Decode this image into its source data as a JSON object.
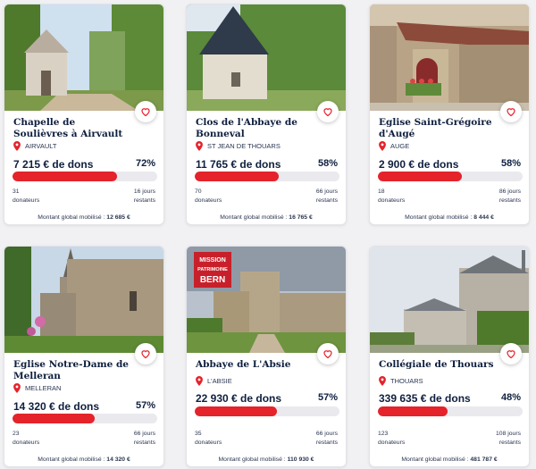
{
  "accent_color": "#e4232b",
  "projects": [
    {
      "title": "Chapelle de Soulièvres à Airvault",
      "location": "AIRVAULT",
      "amount": "7 215 € de dons",
      "percent": "72%",
      "progress": 0.72,
      "donors_count": "31",
      "donors_label": "donateurs",
      "days_count": "16 jours",
      "days_label": "restants",
      "total_label": "Montant global mobilisé :",
      "total_value": "12 685 €"
    },
    {
      "title": "Clos de l'Abbaye de Bonneval",
      "location": "ST JEAN DE THOUARS",
      "amount": "11 765 € de dons",
      "percent": "58%",
      "progress": 0.58,
      "donors_count": "70",
      "donors_label": "donateurs",
      "days_count": "66 jours",
      "days_label": "restants",
      "total_label": "Montant global mobilisé :",
      "total_value": "16 765 €"
    },
    {
      "title": "Eglise Saint-Grégoire d'Augé",
      "location": "AUGE",
      "amount": "2 900 € de dons",
      "percent": "58%",
      "progress": 0.58,
      "donors_count": "18",
      "donors_label": "donateurs",
      "days_count": "86 jours",
      "days_label": "restants",
      "total_label": "Montant global mobilisé :",
      "total_value": "8 444 €"
    },
    {
      "title": "Eglise Notre-Dame de Melleran",
      "location": "MELLERAN",
      "amount": "14 320 € de dons",
      "percent": "57%",
      "progress": 0.57,
      "donors_count": "23",
      "donors_label": "donateurs",
      "days_count": "66 jours",
      "days_label": "restants",
      "total_label": "Montant global mobilisé :",
      "total_value": "14 320 €"
    },
    {
      "title": "Abbaye de L'Absie",
      "location": "L'ABSIE",
      "amount": "22 930 € de dons",
      "percent": "57%",
      "progress": 0.57,
      "donors_count": "35",
      "donors_label": "donateurs",
      "days_count": "66 jours",
      "days_label": "restants",
      "total_label": "Montant global mobilisé :",
      "total_value": "110 930 €",
      "badge": [
        "MISSION",
        "PATRIMOINE",
        "BERN"
      ]
    },
    {
      "title": "Collégiale de Thouars",
      "location": "THOUARS",
      "amount": "339 635 € de dons",
      "percent": "48%",
      "progress": 0.48,
      "donors_count": "123",
      "donors_label": "donateurs",
      "days_count": "108 jours",
      "days_label": "restants",
      "total_label": "Montant global mobilisé :",
      "total_value": "481 787 €"
    }
  ]
}
